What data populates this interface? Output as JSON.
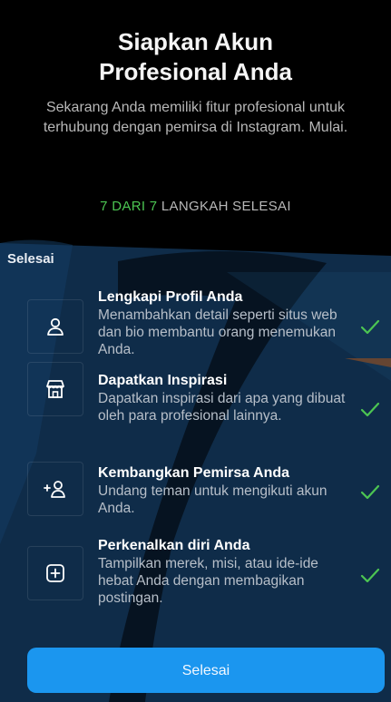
{
  "header": {
    "title_line1": "Siapkan Akun",
    "title_line2": "Profesional Anda",
    "subtitle": "Sekarang Anda memiliki fitur profesional untuk terhubung dengan pemirsa di Instagram. Mulai."
  },
  "progress": {
    "completed": "7 DARI 7",
    "label": "LANGKAH SELESAI"
  },
  "section": {
    "label": "Selesai"
  },
  "steps": [
    {
      "icon": "person-icon",
      "title": "Lengkapi Profil Anda",
      "description": "Menambahkan detail seperti situs web dan bio membantu orang menemukan Anda.",
      "status": "completed"
    },
    {
      "icon": "storefront-icon",
      "title": "Dapatkan Inspirasi",
      "description": "Dapatkan inspirasi dari apa yang dibuat oleh para profesional lainnya.",
      "status": "completed"
    },
    {
      "icon": "add-person-icon",
      "title": "Kembangkan Pemirsa Anda",
      "description": "Undang teman untuk mengikuti akun Anda.",
      "status": "completed"
    },
    {
      "icon": "add-square-icon",
      "title": "Perkenalkan diri Anda",
      "description": "Tampilkan merek, misi, atau ide-ide hebat Anda dengan membagikan postingan.",
      "status": "completed"
    }
  ],
  "button": {
    "label": "Selesai"
  },
  "colors": {
    "background": "#000000",
    "accent": "#1b96ef",
    "progress_done": "#4cc552",
    "check": "#4cc552",
    "watermark": "#0f2c49"
  }
}
